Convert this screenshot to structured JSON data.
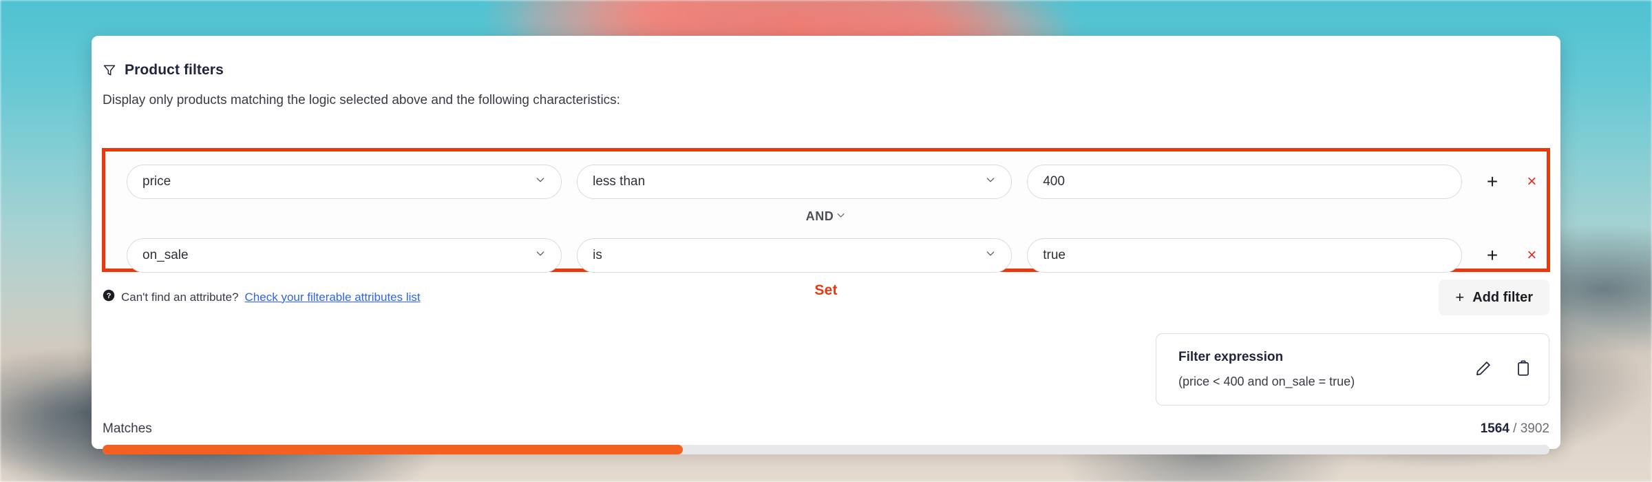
{
  "panel": {
    "title": "Product filters",
    "title_icon": "funnel-icon",
    "subtitle": "Display only products matching the logic selected above and the following characteristics:"
  },
  "filters": {
    "rows": [
      {
        "attribute": "price",
        "operator": "less than",
        "value": "400",
        "add_label": "+",
        "remove_label": "×"
      },
      {
        "attribute": "on_sale",
        "operator": "is",
        "value": "true",
        "add_label": "+",
        "remove_label": "×"
      }
    ],
    "connector": "AND"
  },
  "helper": {
    "icon": "help-circle-icon",
    "text": "Can't find an attribute?",
    "link": "Check your filterable attributes list"
  },
  "annotation": {
    "set_label": "Set",
    "color": "#e8380d"
  },
  "add_filter": {
    "plus": "+",
    "label": "Add filter"
  },
  "expression": {
    "title": "Filter expression",
    "value": "(price < 400 and on_sale = true)",
    "edit_icon": "pencil-icon",
    "copy_icon": "clipboard-icon"
  },
  "matches": {
    "label": "Matches",
    "current": "1564",
    "separator": " / ",
    "total": "3902",
    "percent": 40.1,
    "fill_color": "#f4601f",
    "track_color": "#e8e8ea"
  }
}
